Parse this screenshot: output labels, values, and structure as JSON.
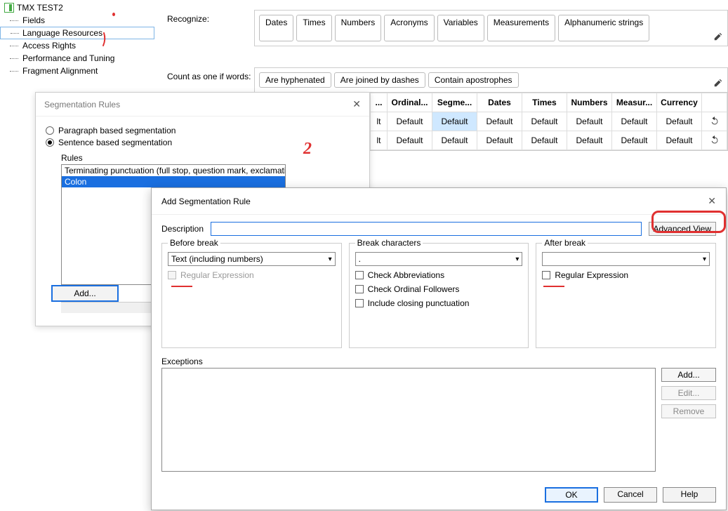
{
  "tree": {
    "root": "TMX TEST2",
    "items": [
      "Fields",
      "Language Resources",
      "Access Rights",
      "Performance and Tuning",
      "Fragment Alignment"
    ],
    "selected_index": 1
  },
  "main": {
    "recognize_label": "Recognize:",
    "recognize_tokens": [
      "Dates",
      "Times",
      "Numbers",
      "Acronyms",
      "Variables",
      "Measurements",
      "Alphanumeric strings"
    ],
    "count_label": "Count as one if words:",
    "count_tokens": [
      "Are hyphenated",
      "Are joined by dashes",
      "Contain apostrophes"
    ]
  },
  "table": {
    "headers": [
      "...",
      "Ordinal...",
      "Segme...",
      "Dates",
      "Times",
      "Numbers",
      "Measur...",
      "Currency",
      ""
    ],
    "rows": [
      [
        "lt",
        "Default",
        "Default",
        "Default",
        "Default",
        "Default",
        "Default",
        "Default",
        "undo"
      ],
      [
        "lt",
        "Default",
        "Default",
        "Default",
        "Default",
        "Default",
        "Default",
        "Default",
        "undo"
      ]
    ],
    "highlight": {
      "row": 0,
      "col": 2
    }
  },
  "seg_dialog": {
    "title": "Segmentation Rules",
    "opt_paragraph": "Paragraph based segmentation",
    "opt_sentence": "Sentence based segmentation",
    "selected_option": "sentence",
    "rules_label": "Rules",
    "rules": [
      "Terminating punctuation (full stop, question mark, exclamation mark",
      "Colon"
    ],
    "selected_rule_index": 1,
    "btn_add": "Add..."
  },
  "add_dialog": {
    "title": "Add Segmentation Rule",
    "description_label": "Description",
    "description_value": "",
    "adv_btn": "Advanced View",
    "before": {
      "title": "Before break",
      "combo": "Text (including numbers)",
      "regex": "Regular Expression"
    },
    "break": {
      "title": "Break characters",
      "combo": ".",
      "chk1": "Check Abbreviations",
      "chk2": "Check Ordinal Followers",
      "chk3": "Include closing punctuation"
    },
    "after": {
      "title": "After break",
      "combo": "",
      "regex": "Regular Expression"
    },
    "exceptions_label": "Exceptions",
    "btn_add": "Add...",
    "btn_edit": "Edit...",
    "btn_remove": "Remove",
    "ok": "OK",
    "cancel": "Cancel",
    "help": "Help"
  }
}
